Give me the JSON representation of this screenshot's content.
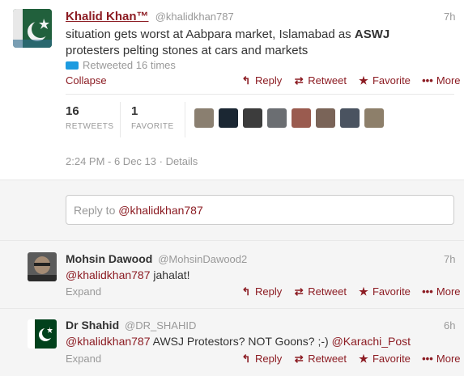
{
  "main_tweet": {
    "fullname": "Khalid Khan™",
    "handle": "@khalidkhan787",
    "time": "7h",
    "text_before": "situation gets worst at Aabpara market, Islamabad as ",
    "text_bold": "ASWJ",
    "text_after": " protesters pelting stones at cars and markets",
    "retweeted_label": "Retweeted 16 times",
    "collapse": "Collapse",
    "actions": {
      "reply": "Reply",
      "retweet": "Retweet",
      "favorite": "Favorite",
      "more": "More"
    },
    "stats": {
      "retweets_count": "16",
      "retweets_label": "RETWEETS",
      "favorites_count": "1",
      "favorites_label": "FAVORITE"
    },
    "timestamp": "2:24 PM - 6 Dec 13",
    "details": "Details"
  },
  "reply_box": {
    "prefix": "Reply to ",
    "mention": "@khalidkhan787"
  },
  "replies": [
    {
      "fullname": "Mohsin Dawood",
      "handle": "@MohsinDawood2",
      "time": "7h",
      "mention": "@khalidkhan787",
      "text": " jahalat!",
      "expand": "Expand"
    },
    {
      "fullname": "Dr Shahid",
      "handle": "@DR_SHAHID",
      "time": "6h",
      "mention": "@khalidkhan787",
      "text": " AWSJ Protestors? NOT Goons? ;-) ",
      "mention2": "@Karachi_Post",
      "expand": "Expand"
    }
  ],
  "icons": {
    "reply": "reply-icon",
    "retweet": "retweet-icon",
    "favorite": "star-icon",
    "more": "more-icon"
  },
  "colors": {
    "link": "#8c1c23",
    "muted": "#999999",
    "rt_blue": "#1d9be0"
  }
}
